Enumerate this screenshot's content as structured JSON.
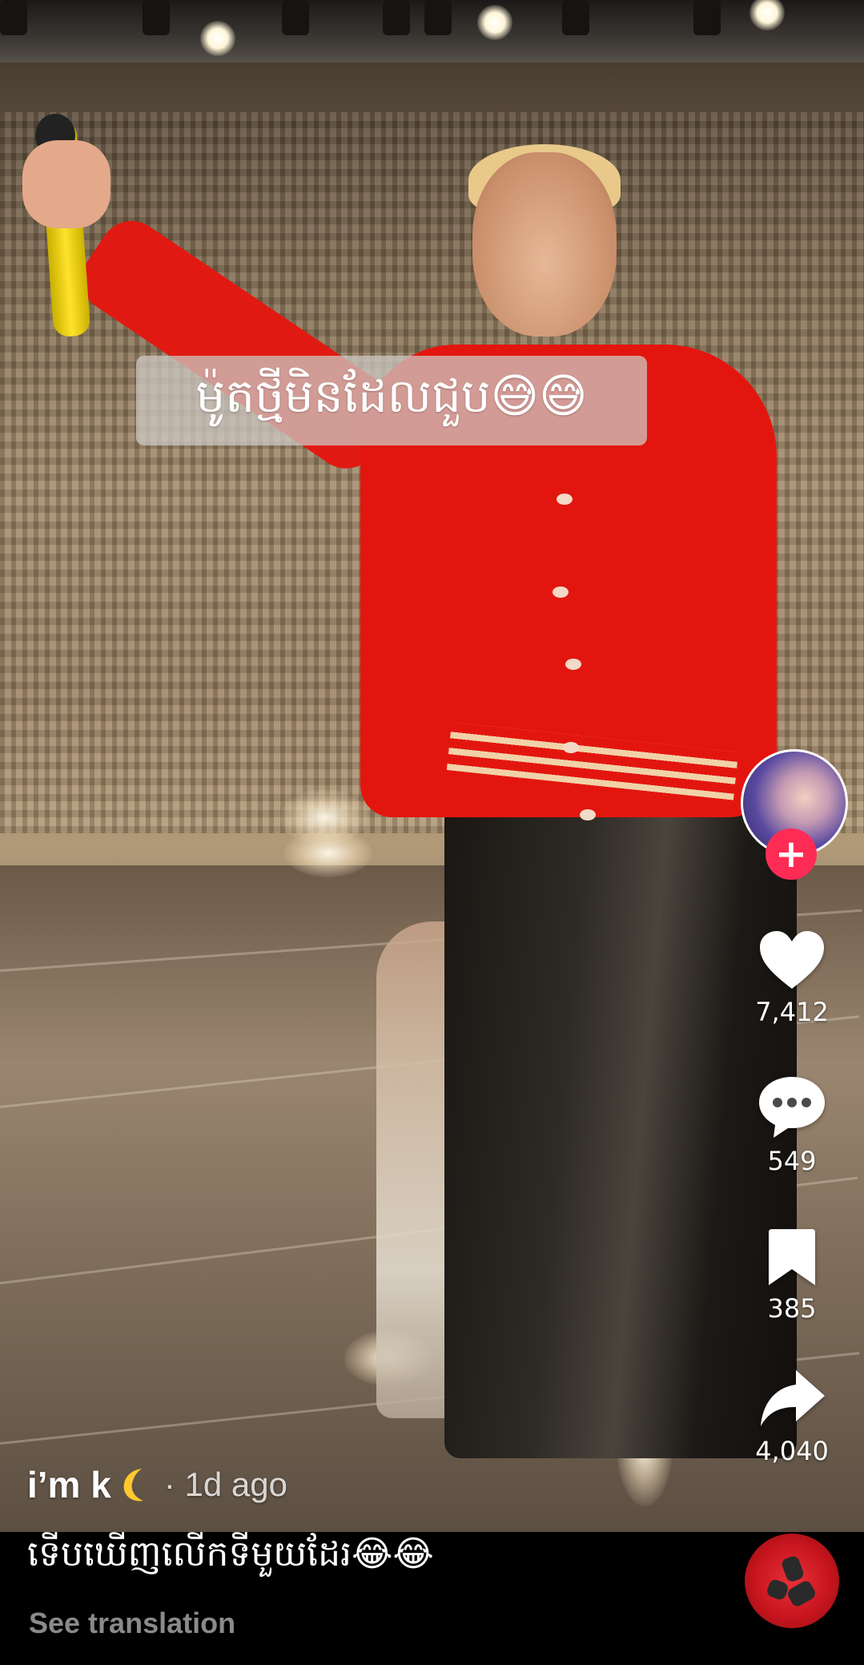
{
  "overlay": {
    "caption_sticker": "ម៉ូតថ្មីមិនដែលជួប😅😅"
  },
  "actions": {
    "like": {
      "icon": "heart-icon",
      "count": "7,412"
    },
    "comment": {
      "icon": "comment-icon",
      "count": "549"
    },
    "bookmark": {
      "icon": "bookmark-icon",
      "count": "385"
    },
    "share": {
      "icon": "share-icon",
      "count": "4,040"
    },
    "follow_symbol": "+"
  },
  "post": {
    "author": "i’m k",
    "timestamp": "· 1d ago",
    "caption": "ទើបឃើញលើកទីមួយដែរ😂😂",
    "see_translation": "See translation"
  },
  "colors": {
    "follow_badge": "#fe2c55",
    "jacket": "#e3160f",
    "muted_text": "#8a8a8a"
  }
}
